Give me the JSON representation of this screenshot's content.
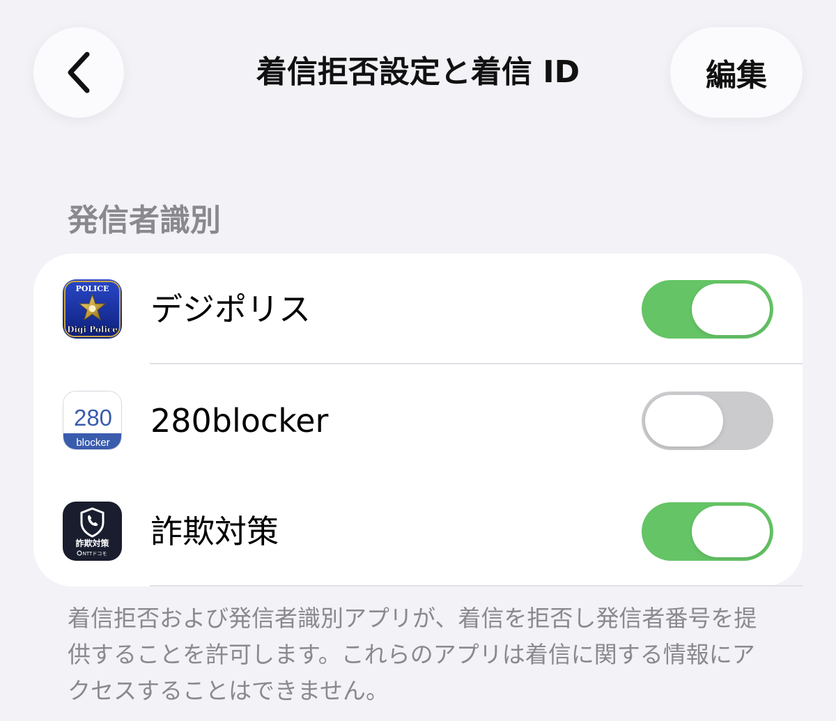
{
  "header": {
    "title": "着信拒否設定と着信 ID",
    "edit_label": "編集",
    "back_icon": "chevron-left-icon"
  },
  "section": {
    "header": "発信者識別",
    "footer": "着信拒否および発信者識別アプリが、着信を拒否し発信者番号を提供することを許可します。これらのアプリは着信に関する情報にアクセスすることはできません。"
  },
  "apps": [
    {
      "label": "デジポリス",
      "enabled": true,
      "icon": "digipolice-app-icon",
      "icon_text_top": "POLICE",
      "icon_text_bottom": "Digi Police"
    },
    {
      "label": "280blocker",
      "enabled": false,
      "icon": "280blocker-app-icon",
      "icon_text_top": "280",
      "icon_text_bottom": "blocker"
    },
    {
      "label": "詐欺対策",
      "enabled": true,
      "icon": "fraud-protection-app-icon",
      "icon_text_top": "詐欺対策",
      "icon_text_bottom": "NTTドコモ"
    }
  ],
  "colors": {
    "background": "#f2f2f7",
    "toggle_on": "#65c466",
    "toggle_off": "#cbcbce",
    "secondary_text": "#8a8a8e"
  }
}
